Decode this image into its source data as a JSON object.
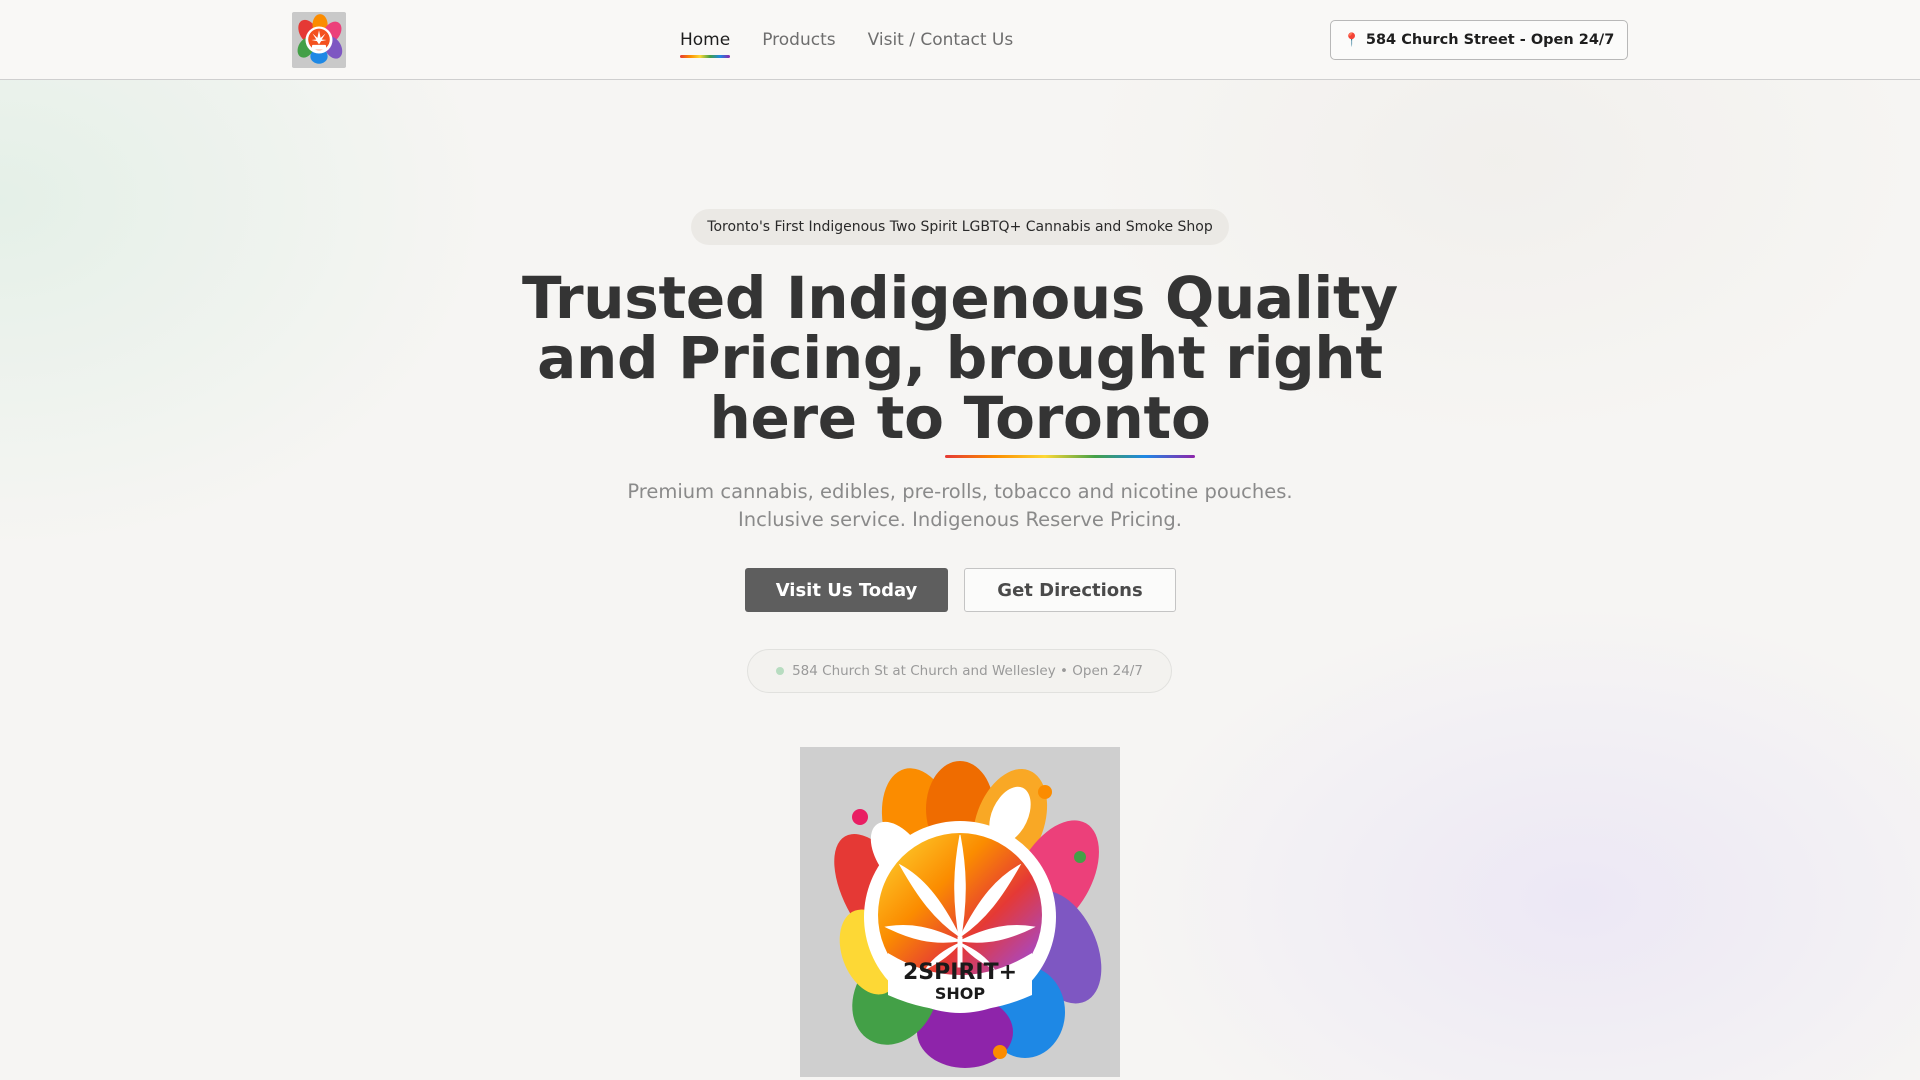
{
  "header": {
    "logo_text": [
      "2SPIRIT+",
      "SHOP"
    ],
    "nav": [
      {
        "label": "Home",
        "active": true
      },
      {
        "label": "Products",
        "active": false
      },
      {
        "label": "Visit / Contact Us",
        "active": false
      }
    ],
    "address_button": "584 Church Street - Open 24/7",
    "address_icon": "map-pin-icon"
  },
  "hero": {
    "tagline": "Toronto's First Indigenous Two Spirit LGBTQ+ Cannabis and Smoke Shop",
    "headline_lines": [
      "Trusted Indigenous Quality",
      "and Pricing, brought right",
      "here to Toronto"
    ],
    "subtext_lines": [
      "Premium cannabis, edibles, pre-rolls, tobacco and nicotine pouches.",
      "Inclusive service. Indigenous Reserve Pricing."
    ],
    "primary_cta": "Visit Us Today",
    "secondary_cta": "Get Directions",
    "location_status": "584 Church St at Church and Wellesley • Open 24/7",
    "logo_text": [
      "2SPIRIT+",
      "SHOP"
    ]
  },
  "colors": {
    "accent_rainbow": [
      "#e53935",
      "#fb8c00",
      "#fdd835",
      "#43a047",
      "#1e88e5",
      "#8e24aa"
    ],
    "primary_button": "#5e5e5e",
    "status_dot": "#b7dcc0"
  }
}
